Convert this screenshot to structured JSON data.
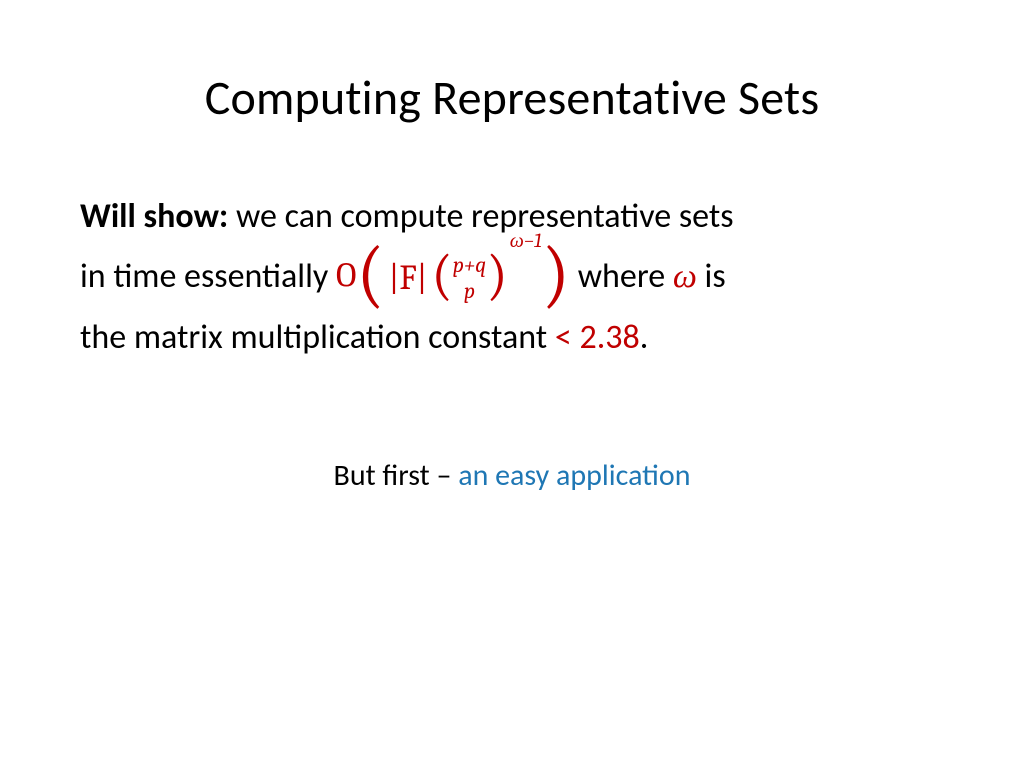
{
  "title": "Computing Representative Sets",
  "body": {
    "will_show_label": "Will show:",
    "line1_part1": " we can compute representative sets",
    "line2_prefix": "in time essentially ",
    "line2_suffix_a": " where ",
    "line2_suffix_b": " is",
    "line3_prefix": "the matrix multiplication constant ",
    "bound": "< 2.38",
    "line3_suffix": "."
  },
  "formula": {
    "big_o": "O",
    "lparen_big": "(",
    "abs_f": "|F|",
    "binom_lparen": "(",
    "binom_top": "p+q",
    "binom_bot": "p",
    "binom_rparen": ")",
    "exponent": "ω−1",
    "rparen_big": ")",
    "omega": "ω"
  },
  "subtitle": {
    "prefix": "But first – ",
    "accent": "an easy application"
  }
}
